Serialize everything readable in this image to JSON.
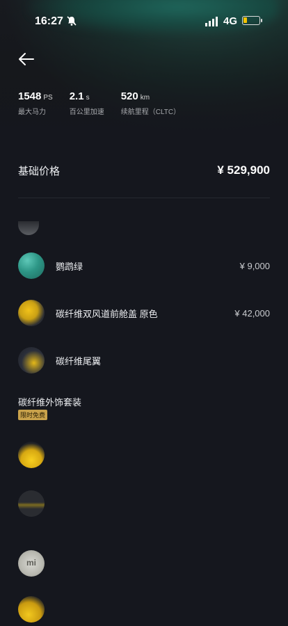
{
  "status": {
    "time": "16:27",
    "network": "4G",
    "battery_level": 0.25
  },
  "specs": [
    {
      "value": "1548",
      "unit": "PS",
      "label": "最大马力"
    },
    {
      "value": "2.1",
      "unit": "s",
      "label": "百公里加速"
    },
    {
      "value": "520",
      "unit": "km",
      "label": "续航里程（CLTC）"
    }
  ],
  "base_price": {
    "label": "基础价格",
    "value": "¥ 529,900"
  },
  "options": [
    {
      "name": "鹦鹉绿",
      "price": "¥ 9,000",
      "icon": "paint-swatch-icon"
    },
    {
      "name": "碳纤维双风道前舱盖 原色",
      "price": "¥ 42,000",
      "icon": "hood-icon"
    },
    {
      "name": "碳纤维尾翼",
      "price": "",
      "icon": "rear-wing-icon"
    }
  ],
  "package": {
    "title": "碳纤维外饰套装",
    "badge": "限时免费",
    "logo_text": "mi"
  },
  "colors": {
    "background": "#15171e",
    "badge": "#c9a24b",
    "accent_yellow": "#f1c21a",
    "accent_green": "#2d9686"
  }
}
